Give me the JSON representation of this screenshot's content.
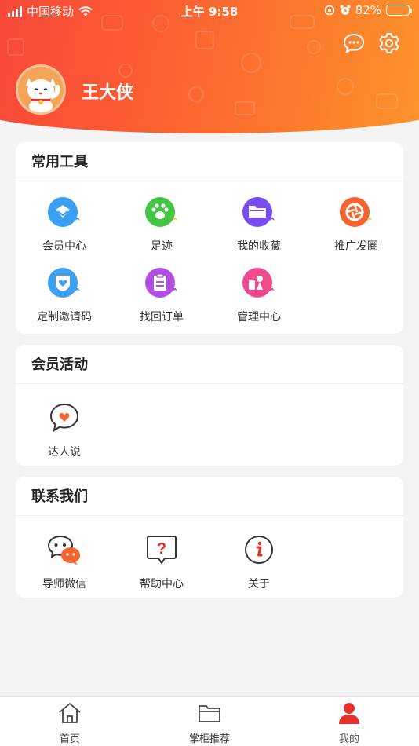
{
  "status_bar": {
    "carrier": "中国移动",
    "time": "上午 9:58",
    "battery_percent": "82%",
    "battery_level": 0.82
  },
  "profile": {
    "username": "王大侠"
  },
  "header_icons": [
    "chat-bubble-icon",
    "gear-icon"
  ],
  "sections": {
    "tools": {
      "title": "常用工具",
      "items": [
        {
          "label": "会员中心",
          "icon": "member-center-icon",
          "color": "#3aa0f5"
        },
        {
          "label": "足迹",
          "icon": "footprint-icon",
          "color": "#43c443"
        },
        {
          "label": "我的收藏",
          "icon": "folder-icon",
          "color": "#7a4df2"
        },
        {
          "label": "推广发圈",
          "icon": "aperture-icon",
          "color": "#f5642e"
        },
        {
          "label": "定制邀请码",
          "icon": "shield-heart-icon",
          "color": "#3aa0f5"
        },
        {
          "label": "找回订单",
          "icon": "clipboard-icon",
          "color": "#b34de3"
        },
        {
          "label": "管理中心",
          "icon": "manage-icon",
          "color": "#f04a8c"
        }
      ]
    },
    "activities": {
      "title": "会员活动",
      "items": [
        {
          "label": "达人说",
          "icon": "heart-chat-icon"
        }
      ]
    },
    "contact": {
      "title": "联系我们",
      "items": [
        {
          "label": "导师微信",
          "icon": "wechat-icon"
        },
        {
          "label": "帮助中心",
          "icon": "help-icon"
        },
        {
          "label": "关于",
          "icon": "info-icon"
        }
      ]
    }
  },
  "tabbar": {
    "items": [
      {
        "label": "首页",
        "icon": "home-icon"
      },
      {
        "label": "掌柜推荐",
        "icon": "folder-icon"
      },
      {
        "label": "我的",
        "icon": "user-icon",
        "active": true
      }
    ],
    "active_color": "#e8302a"
  }
}
